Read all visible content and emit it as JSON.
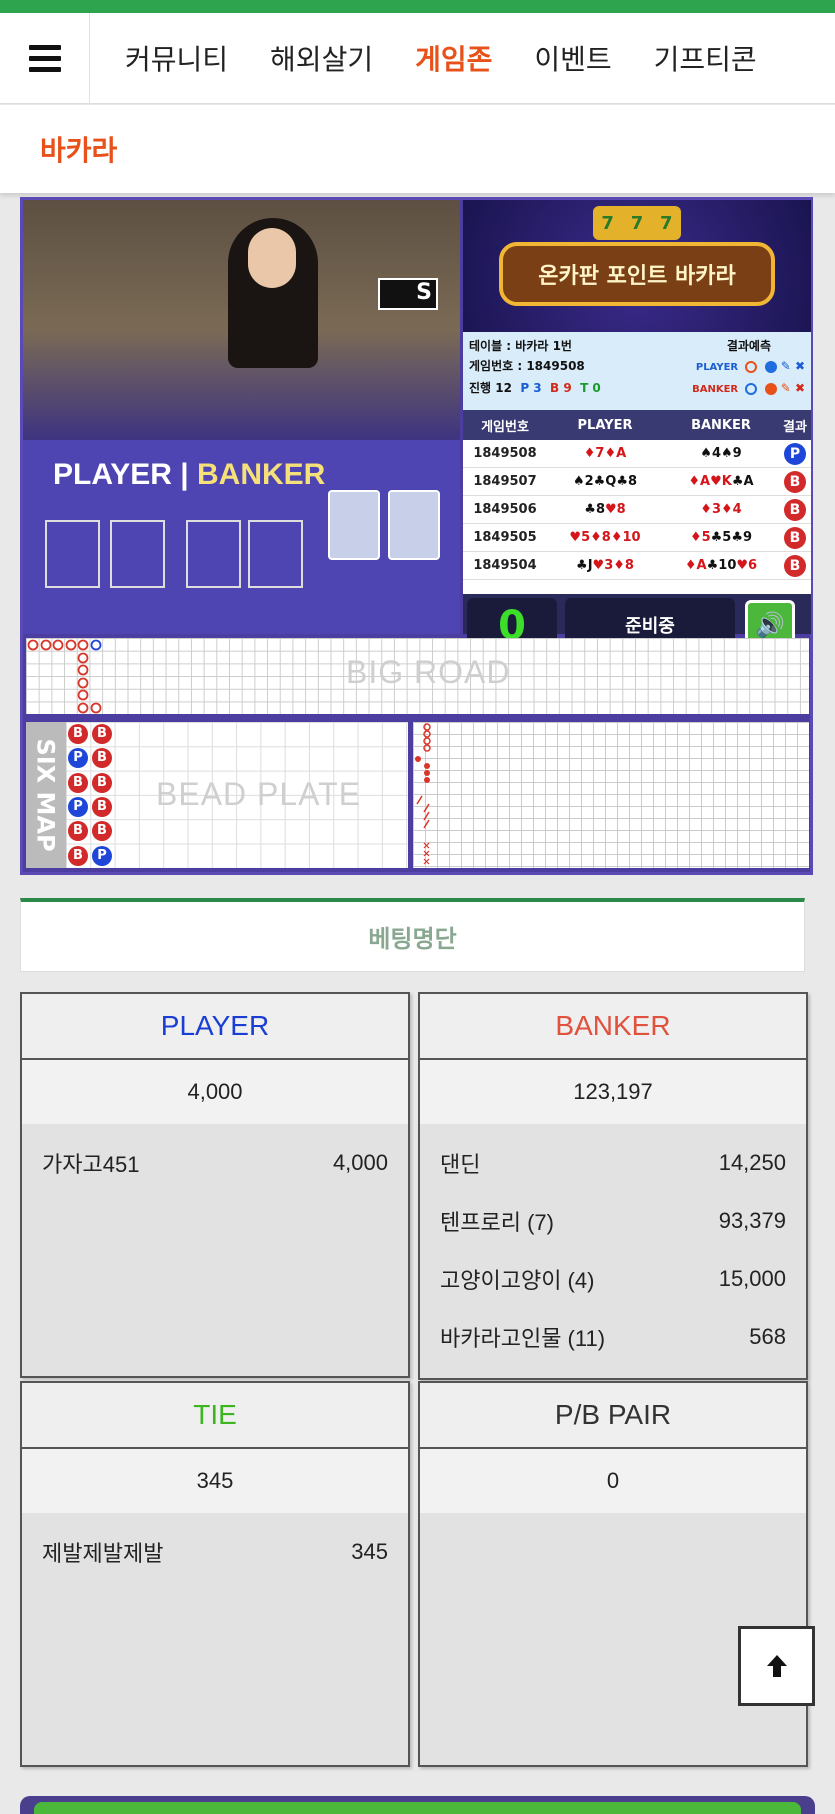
{
  "nav": {
    "items": [
      {
        "label": "커뮤니티",
        "active": false
      },
      {
        "label": "해외살기",
        "active": false
      },
      {
        "label": "게임존",
        "active": true
      },
      {
        "label": "이벤트",
        "active": false
      },
      {
        "label": "기프티콘",
        "active": false
      }
    ]
  },
  "page": {
    "title": "바카라"
  },
  "game": {
    "video": {
      "player_label": "PLAYER",
      "banker_label": "BANKER"
    },
    "promo_title": "온카판 포인트 바카라",
    "table_label": "테이블 : 바카라 1번",
    "prediction_label": "결과예측",
    "round_label": "게임번호 : 1849508",
    "progress_label": "진행 12",
    "counts": {
      "p": "P 3",
      "b": "B 9",
      "t": "T 0"
    },
    "player_tag": "PLAYER",
    "banker_tag": "BANKER",
    "history_headers": [
      "게임번호",
      "PLAYER",
      "BANKER",
      "결과"
    ],
    "history": [
      {
        "no": "1849508",
        "player": "♦7♦A",
        "banker": "♠4♠9",
        "result": "P"
      },
      {
        "no": "1849507",
        "player": "♠2♣Q♣8",
        "banker": "♦A♥K♣A",
        "result": "B"
      },
      {
        "no": "1849506",
        "player": "♣8♥8",
        "banker": "♦3♦4",
        "result": "B"
      },
      {
        "no": "1849505",
        "player": "♥5♦8♦10",
        "banker": "♦5♣5♣9",
        "result": "B"
      },
      {
        "no": "1849504",
        "player": "♣J♥3♦8",
        "banker": "♦A♣10♥6",
        "result": "B"
      }
    ],
    "timer": "0",
    "status": "준비중",
    "big_road_label": "BIG ROAD",
    "six_map_label": "SIX MAP",
    "bead_plate_label": "BEAD PLATE",
    "bead": [
      [
        "B",
        "B"
      ],
      [
        "P",
        "B"
      ],
      [
        "B",
        "B"
      ],
      [
        "P",
        "B"
      ],
      [
        "B",
        "B"
      ],
      [
        "B",
        "P"
      ]
    ]
  },
  "betting": {
    "title": "베팅명단",
    "player": {
      "label": "PLAYER",
      "color": "#1a3ed4",
      "total": "4,000",
      "entries": [
        {
          "name": "가자고451",
          "amount": "4,000"
        }
      ]
    },
    "banker": {
      "label": "BANKER",
      "color": "#e0513e",
      "total": "123,197",
      "entries": [
        {
          "name": "댄딘",
          "amount": "14,250"
        },
        {
          "name": "텐프로리 (7)",
          "amount": "93,379"
        },
        {
          "name": "고양이고양이 (4)",
          "amount": "15,000"
        },
        {
          "name": "바카라고인물 (11)",
          "amount": "568"
        }
      ]
    },
    "tie": {
      "label": "TIE",
      "color": "#3cb521",
      "total": "345",
      "entries": [
        {
          "name": "제발제발제발",
          "amount": "345"
        }
      ]
    },
    "pair": {
      "label": "P/B PAIR",
      "color": "#333333",
      "total": "0",
      "entries": []
    }
  },
  "colors": {
    "accent": "#e8521a",
    "green": "#2ea44f"
  }
}
